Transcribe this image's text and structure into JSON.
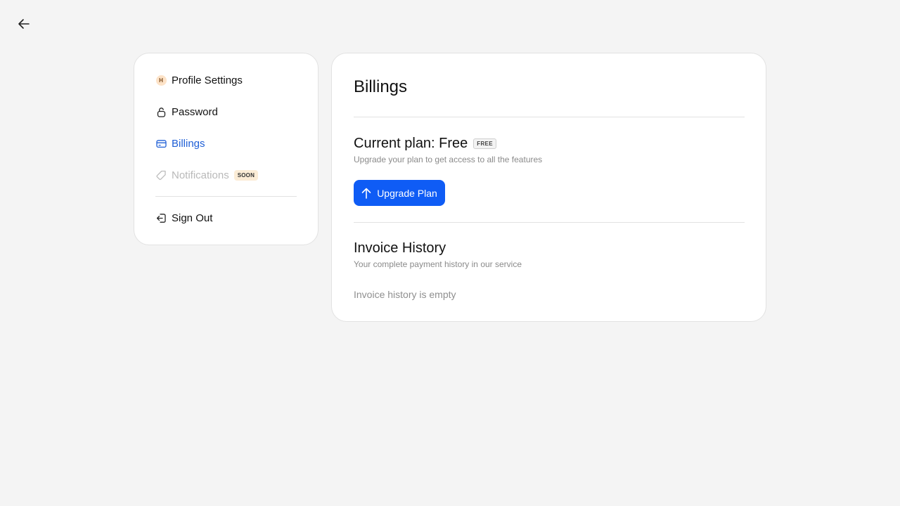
{
  "header": {
    "back_icon": "arrow-left-icon"
  },
  "sidebar": {
    "items": [
      {
        "label": "Profile Settings",
        "icon": "avatar",
        "avatar_initial": "H"
      },
      {
        "label": "Password",
        "icon": "lock-icon"
      },
      {
        "label": "Billings",
        "icon": "credit-card-icon",
        "active": true
      },
      {
        "label": "Notifications",
        "icon": "tag-icon",
        "disabled": true,
        "badge": "SOON"
      },
      {
        "label": "Sign Out",
        "icon": "sign-out-icon"
      }
    ]
  },
  "main": {
    "title": "Billings",
    "plan": {
      "title": "Current plan: Free",
      "badge": "FREE",
      "subtitle": "Upgrade your plan to get access to all the features",
      "button_label": "Upgrade Plan"
    },
    "invoices": {
      "title": "Invoice History",
      "subtitle": "Your complete payment history in our service",
      "empty_text": "Invoice history is empty"
    }
  },
  "colors": {
    "accent": "#0f5cf5",
    "active_nav": "#1f5fd6",
    "background": "#f4f4f4"
  }
}
